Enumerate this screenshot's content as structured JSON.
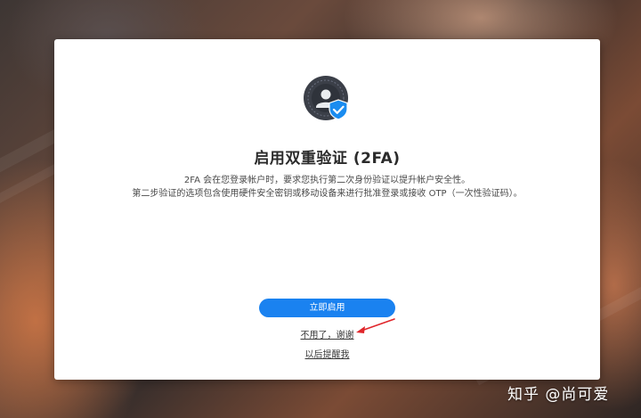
{
  "dialog": {
    "title": "启用双重验证 (2FA)",
    "description_line1": "2FA 会在您登录帐户时，要求您执行第二次身份验证以提升帐户安全性。",
    "description_line2": "第二步验证的选项包含使用硬件安全密钥或移动设备来进行批准登录或接收 OTP（一次性验证码）。",
    "icon": "user-shield-check-icon",
    "enable_button_label": "立即启用",
    "decline_link_label": "不用了，谢谢",
    "remind_later_link_label": "以后提醒我"
  },
  "watermark": {
    "text": "知乎 @尚可爱"
  },
  "colors": {
    "primary": "#1a82f0",
    "annotation_arrow": "#e0262b",
    "shield": "#1a8cf0",
    "icon_disc": "#3b3f48"
  }
}
